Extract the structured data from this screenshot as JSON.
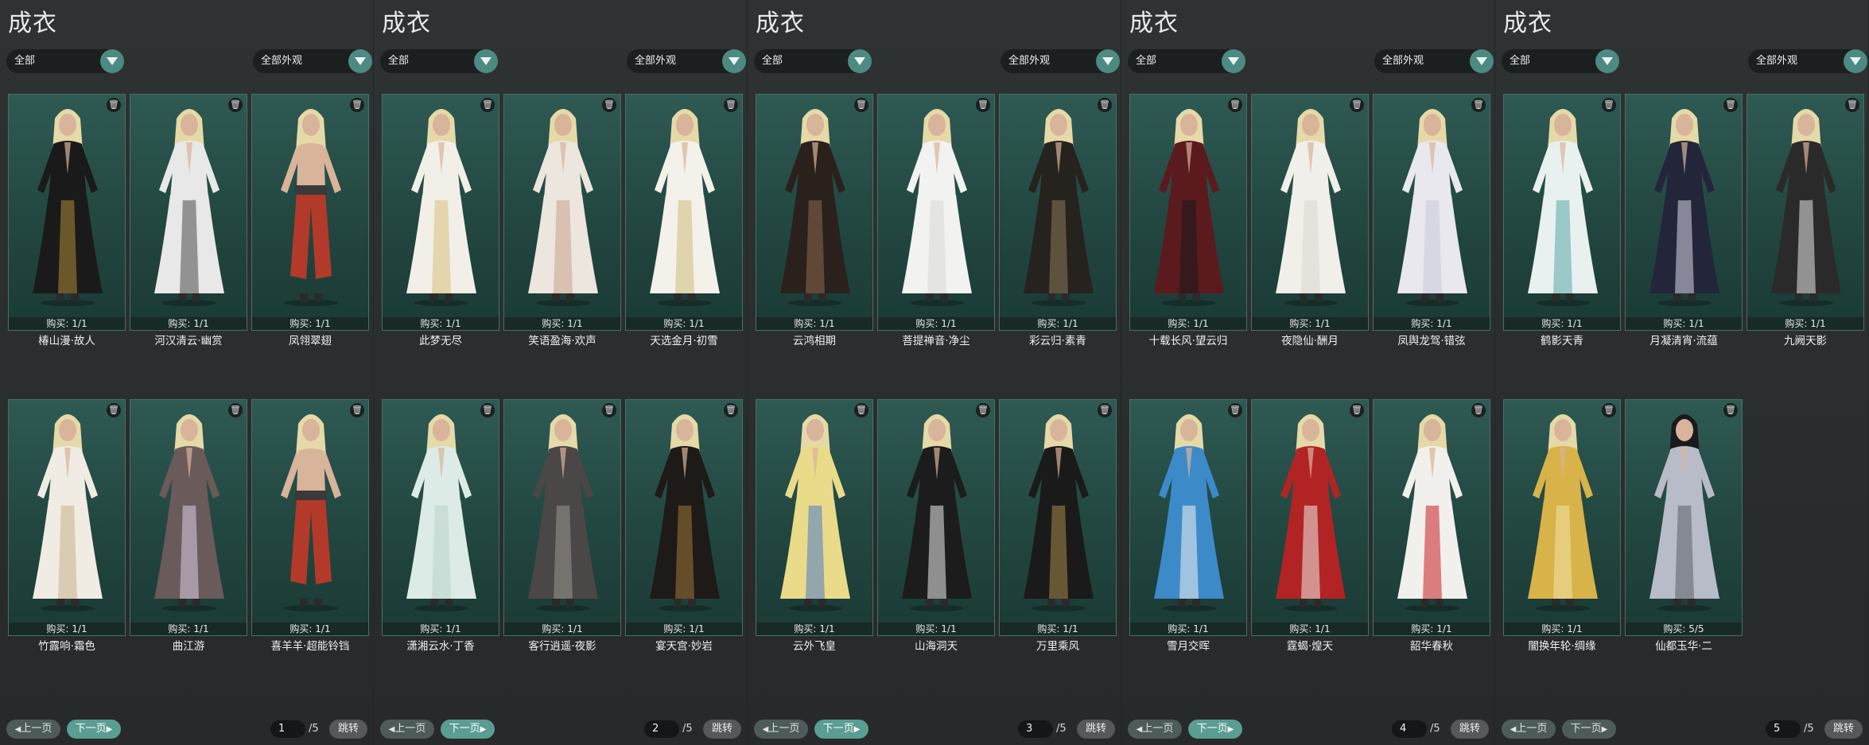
{
  "panels": [
    {
      "title": "成衣",
      "category_filter": "全部",
      "appearance_filter": "全部外观",
      "items": [
        {
          "name": "椿山漫·故人",
          "buy": "购买: 1/1",
          "outfit_color": "#1a1a1a",
          "accent": "#b08a3a",
          "skin": false
        },
        {
          "name": "河汉清云·幽赏",
          "buy": "购买: 1/1",
          "outfit_color": "#e8e8e8",
          "accent": "#4a4a4a",
          "skin": false
        },
        {
          "name": "凤翎翠翅",
          "buy": "购买: 1/1",
          "outfit_color": "#b33a2a",
          "accent": "#3a3a3a",
          "skin": true
        },
        {
          "name": "竹露响·霜色",
          "buy": "购买: 1/1",
          "outfit_color": "#f0ece4",
          "accent": "#c9b28a",
          "skin": false
        },
        {
          "name": "曲江游",
          "buy": "购买: 1/1",
          "outfit_color": "#6b5a5a",
          "accent": "#d8cfe8",
          "skin": false
        },
        {
          "name": "喜羊羊·超能铃铛",
          "buy": "购买: 1/1",
          "outfit_color": "#b33a2a",
          "accent": "#3a3a3a",
          "skin": true
        }
      ],
      "prev_label": "上一页",
      "prev_active": false,
      "next_label": "下一页",
      "next_active": true,
      "page": "1",
      "total": "/5",
      "jump_label": "跳转"
    },
    {
      "title": "成衣",
      "category_filter": "全部",
      "appearance_filter": "全部外观",
      "items": [
        {
          "name": "此梦无尽",
          "buy": "购买: 1/1",
          "outfit_color": "#f1efe8",
          "accent": "#d8c07a",
          "skin": false
        },
        {
          "name": "笑语盈海·欢声",
          "buy": "购买: 1/1",
          "outfit_color": "#ece6de",
          "accent": "#caa08a",
          "skin": false
        },
        {
          "name": "天选金月·初雪",
          "buy": "购买: 1/1",
          "outfit_color": "#f3f1ea",
          "accent": "#cfbb7a",
          "skin": false
        },
        {
          "name": "潇湘云水·丁香",
          "buy": "购买: 1/1",
          "outfit_color": "#dcebe6",
          "accent": "#bcd4cc",
          "skin": false
        },
        {
          "name": "客行逍遥·夜影",
          "buy": "购买: 1/1",
          "outfit_color": "#4a4746",
          "accent": "#9a9590",
          "skin": false
        },
        {
          "name": "宴天宫·妙岩",
          "buy": "购买: 1/1",
          "outfit_color": "#1e1a17",
          "accent": "#a0793a",
          "skin": false
        }
      ],
      "prev_label": "上一页",
      "prev_active": false,
      "next_label": "下一页",
      "next_active": true,
      "page": "2",
      "total": "/5",
      "jump_label": "跳转"
    },
    {
      "title": "成衣",
      "category_filter": "全部",
      "appearance_filter": "全部外观",
      "items": [
        {
          "name": "云鸿相期",
          "buy": "购买: 1/1",
          "outfit_color": "#2a211d",
          "accent": "#8a6a4a",
          "skin": false
        },
        {
          "name": "菩提禅音·净尘",
          "buy": "购买: 1/1",
          "outfit_color": "#f2f2f0",
          "accent": "#d8d8d8",
          "skin": false
        },
        {
          "name": "彩云归·素青",
          "buy": "购买: 1/1",
          "outfit_color": "#26221e",
          "accent": "#8a7a5a",
          "skin": false
        },
        {
          "name": "云外飞皇",
          "buy": "购买: 1/1",
          "outfit_color": "#eadb8a",
          "accent": "#4a7ac8",
          "skin": false
        },
        {
          "name": "山海洞天",
          "buy": "购买: 1/1",
          "outfit_color": "#1c1c1c",
          "accent": "#efefef",
          "skin": false
        },
        {
          "name": "万里乘风",
          "buy": "购买: 1/1",
          "outfit_color": "#1a1a1a",
          "accent": "#a88a4a",
          "skin": false
        }
      ],
      "prev_label": "上一页",
      "prev_active": false,
      "next_label": "下一页",
      "next_active": true,
      "page": "3",
      "total": "/5",
      "jump_label": "跳转"
    },
    {
      "title": "成衣",
      "category_filter": "全部",
      "appearance_filter": "全部外观",
      "items": [
        {
          "name": "十载长风·望云归",
          "buy": "购买: 1/1",
          "outfit_color": "#5a1a1e",
          "accent": "#1a1a1a",
          "skin": false
        },
        {
          "name": "夜隐仙·酬月",
          "buy": "购买: 1/1",
          "outfit_color": "#f0efea",
          "accent": "#d8d8d0",
          "skin": false
        },
        {
          "name": "凤舆龙驾·错弦",
          "buy": "购买: 1/1",
          "outfit_color": "#e8e8ee",
          "accent": "#c9c9dc",
          "skin": false
        },
        {
          "name": "雪月交晖",
          "buy": "购买: 1/1",
          "outfit_color": "#3d8ac8",
          "accent": "#f2f2f2",
          "skin": false
        },
        {
          "name": "霆蝎·煌天",
          "buy": "购买: 1/1",
          "outfit_color": "#b22424",
          "accent": "#ecece8",
          "skin": false
        },
        {
          "name": "韶华春秋",
          "buy": "购买: 1/1",
          "outfit_color": "#f2f0ec",
          "accent": "#c81f24",
          "skin": false
        }
      ],
      "prev_label": "上一页",
      "prev_active": false,
      "next_label": "下一页",
      "next_active": true,
      "page": "4",
      "total": "/5",
      "jump_label": "跳转"
    },
    {
      "title": "成衣",
      "category_filter": "全部",
      "appearance_filter": "全部外观",
      "items": [
        {
          "name": "鹤影天青",
          "buy": "购买: 1/1",
          "outfit_color": "#e9f1f0",
          "accent": "#5aa8a8",
          "skin": false
        },
        {
          "name": "月凝清宵·流蕴",
          "buy": "购买: 1/1",
          "outfit_color": "#23253a",
          "accent": "#d8d8e8",
          "skin": false
        },
        {
          "name": "九阙天影",
          "buy": "购买: 1/1",
          "outfit_color": "#2a2a2a",
          "accent": "#e8e8e8",
          "skin": false
        },
        {
          "name": "闇换年轮·绸缘",
          "buy": "购买: 1/1",
          "outfit_color": "#d8b34a",
          "accent": "#f0e2a8",
          "skin": false
        },
        {
          "name": "仙都玉华·二",
          "buy": "购买: 5/5",
          "outfit_color": "#b8bcc8",
          "accent": "#5a5e6a",
          "skin": false,
          "dark_hair": true
        }
      ],
      "prev_label": "上一页",
      "prev_active": false,
      "next_label": "下一页",
      "next_active": false,
      "page": "5",
      "total": "/5",
      "jump_label": "跳转"
    }
  ],
  "colors": {
    "card_bg_top": "#2e5a53",
    "card_bg_bottom": "#1b3a35",
    "accent_teal": "#5a9d92",
    "hair_blonde": "#e6d9a8",
    "skin": "#d8b49a"
  }
}
